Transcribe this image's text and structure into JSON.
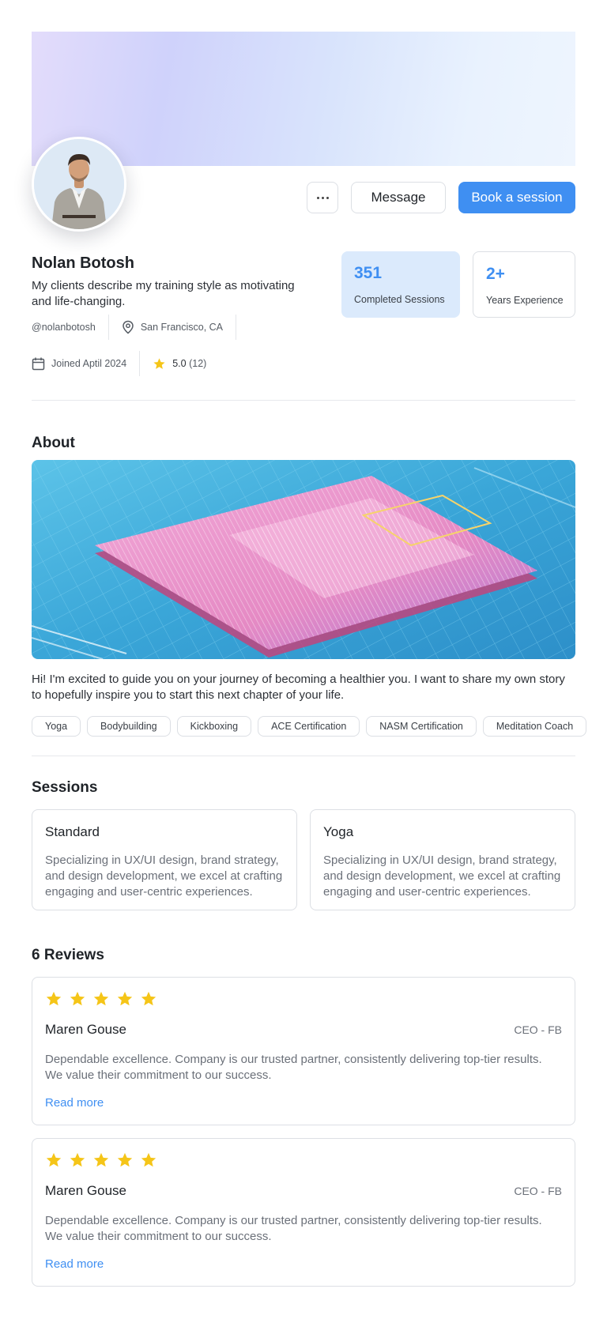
{
  "profile": {
    "name": "Nolan Botosh",
    "bio": "My clients describe my training style as motivating and life-changing.",
    "handle": "@nolanbotosh",
    "location": "San Francisco, CA",
    "joined": "Joined Aptil 2024",
    "rating": "5.0",
    "rating_count": "(12)"
  },
  "actions": {
    "more_label": "⋯",
    "message_label": "Message",
    "book_label": "Book a session"
  },
  "stats": [
    {
      "value": "351",
      "label": "Completed Sessions"
    },
    {
      "value": "2+",
      "label": "Years Experience"
    }
  ],
  "about": {
    "heading": "About",
    "text": "Hi! I'm excited to guide you on your journey of becoming a healthier you. I want to share my own story to hopefully inspire you to start this next chapter of your life.",
    "tags": [
      "Yoga",
      "Bodybuilding",
      "Kickboxing",
      "ACE Certification",
      "NASM Certification",
      "Meditation Coach"
    ]
  },
  "sessions": {
    "heading": "Sessions",
    "items": [
      {
        "title": "Standard",
        "description": "Specializing in UX/UI design, brand strategy, and design development, we excel at crafting engaging and user-centric experiences."
      },
      {
        "title": "Yoga",
        "description": "Specializing in UX/UI design, brand strategy, and design development, we excel at crafting engaging and user-centric experiences."
      }
    ]
  },
  "reviews": {
    "heading": "6 Reviews",
    "items": [
      {
        "rating": 5,
        "name": "Maren Gouse",
        "role": "CEO - FB",
        "text": "Dependable excellence. Company is our trusted partner, consistently delivering top-tier results. We value their commitment to our success.",
        "link": "Read more"
      },
      {
        "rating": 5,
        "name": "Maren Gouse",
        "role": "CEO - FB",
        "text": "Dependable excellence. Company is our trusted partner, consistently delivering top-tier results. We value their commitment to our success.",
        "link": "Read more"
      }
    ]
  },
  "colors": {
    "accent": "#3f8ff2",
    "star": "#f5c518",
    "stat_bg": "#dbeafc"
  },
  "icons": {
    "more": "more-dots-icon",
    "location": "location-pin-icon",
    "calendar": "calendar-icon",
    "star": "star-icon"
  }
}
